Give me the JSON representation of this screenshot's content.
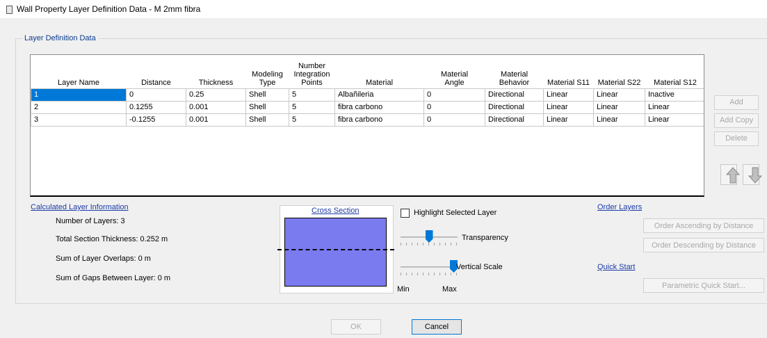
{
  "window": {
    "title": "Wall Property Layer Definition Data - M 2mm fibra"
  },
  "group": {
    "label": "Layer Definition Data"
  },
  "grid": {
    "headers": [
      [
        "Layer Name"
      ],
      [
        "Distance"
      ],
      [
        "Thickness"
      ],
      [
        "Modeling",
        "Type"
      ],
      [
        "Number",
        "Integration",
        "Points"
      ],
      [
        "Material"
      ],
      [
        "Material",
        "Angle"
      ],
      [
        "Material",
        "Behavior"
      ],
      [
        "Material S11"
      ],
      [
        "Material S22"
      ],
      [
        "Material S12"
      ]
    ],
    "rows": [
      [
        "1",
        "0",
        "0.25",
        "Shell",
        "5",
        "Albañileria",
        "0",
        "Directional",
        "Linear",
        "Linear",
        "Inactive"
      ],
      [
        "2",
        "0.1255",
        "0.001",
        "Shell",
        "5",
        "fibra carbono",
        "0",
        "Directional",
        "Linear",
        "Linear",
        "Linear"
      ],
      [
        "3",
        "-0.1255",
        "0.001",
        "Shell",
        "5",
        "fibra carbono",
        "0",
        "Directional",
        "Linear",
        "Linear",
        "Linear"
      ]
    ]
  },
  "side_buttons": {
    "add": "Add",
    "add_copy": "Add Copy",
    "delete": "Delete"
  },
  "calc": {
    "title": "Calculated Layer Information",
    "num_layers": "Number of Layers:  3",
    "total_thickness": "Total Section Thickness:  0.252 m",
    "overlaps": "Sum of Layer Overlaps:  0 m",
    "gaps": "Sum of Gaps Between Layer:  0 m"
  },
  "cross_section": {
    "label": "Cross Section",
    "fill_color": "#7b7bf0"
  },
  "display": {
    "highlight_label": "Highlight Selected Layer",
    "highlight_checked": false,
    "transparency_label": "Transparency",
    "transparency_value": 0.5,
    "vertical_scale_label": "Vertical Scale",
    "vertical_scale_value": 1.0,
    "min_label": "Min",
    "max_label": "Max"
  },
  "order": {
    "title": "Order Layers",
    "ascending": "Order Ascending by Distance",
    "descending": "Order Descending by Distance"
  },
  "quick_start": {
    "title": "Quick Start",
    "parametric": "Parametric Quick Start..."
  },
  "footer": {
    "ok": "OK",
    "cancel": "Cancel"
  },
  "colors": {
    "selection": "#0078d7",
    "link": "#1a3aa6"
  }
}
